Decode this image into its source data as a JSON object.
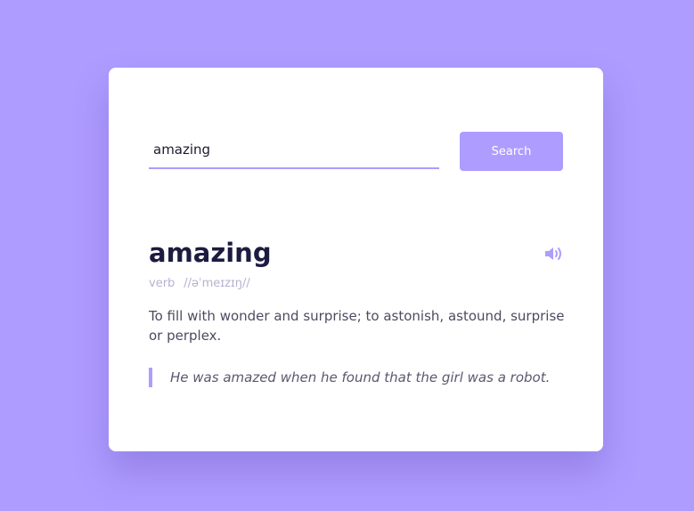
{
  "search": {
    "value": "amazing",
    "button_label": "Search"
  },
  "entry": {
    "word": "amazing",
    "part_of_speech": "verb",
    "phonetic": "//əˈmeɪzɪŋ//",
    "definition": "To fill with wonder and surprise; to astonish, astound, surprise or perplex.",
    "example": "He was amazed when he found that the girl was a robot."
  },
  "icons": {
    "sound": "speaker-icon"
  },
  "colors": {
    "background": "#ae9cff",
    "accent": "#ae9cff",
    "card": "#ffffff",
    "word": "#1d1b3f",
    "muted": "#b8b1d1",
    "text": "#4d4b5f"
  }
}
